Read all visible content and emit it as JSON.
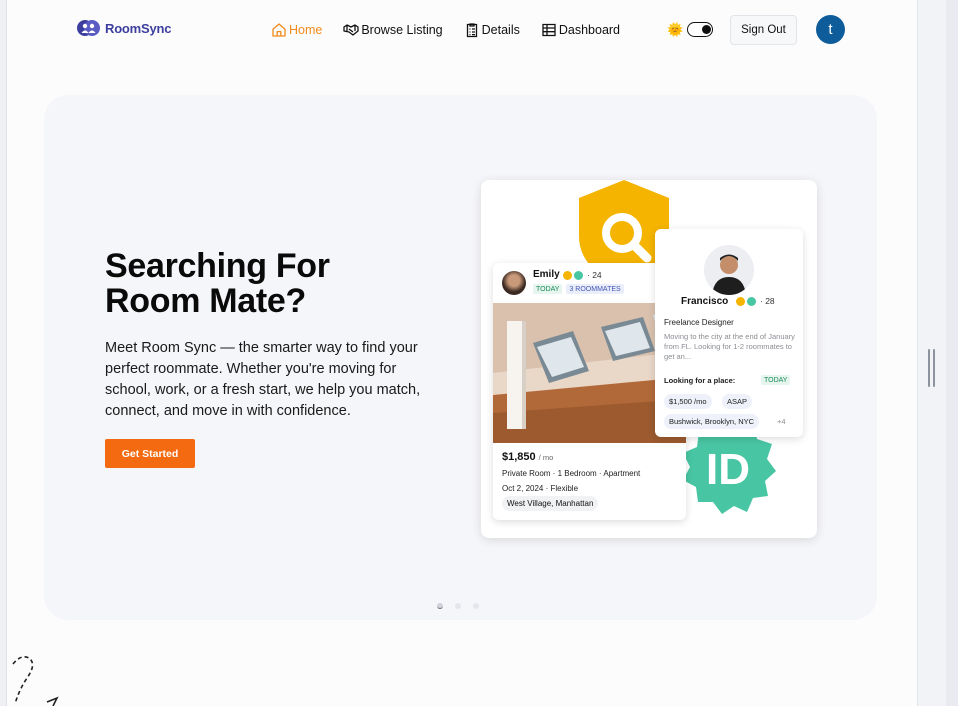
{
  "nav": {
    "logo_text": "RoomSync",
    "links": [
      {
        "label": "Home",
        "icon": "home-icon",
        "active": true
      },
      {
        "label": "Browse Listing",
        "icon": "handshake-icon"
      },
      {
        "label": "Details",
        "icon": "clipboard-icon"
      },
      {
        "label": "Dashboard",
        "icon": "table-icon"
      }
    ],
    "theme_emoji": "🌞",
    "theme_toggle_on": true,
    "sign_out_label": "Sign Out",
    "avatar_initial": "t"
  },
  "hero": {
    "title": "Searching For Room Mate?",
    "description": "Meet Room Sync — the smarter way to find your perfect roommate. Whether you're moving for school, work, or a fresh start, we help you match, connect, and move in with confidence.",
    "cta_label": "Get Started",
    "carousel_dots": 3,
    "active_dot": 0
  },
  "illustration": {
    "emily": {
      "name": "Emily",
      "age": "· 24",
      "tags": [
        "TODAY",
        "3 ROOMMATES"
      ],
      "price": "$1,850",
      "price_unit": "/ mo",
      "room_info": "Private Room · 1 Bedroom · Apartment",
      "date_info": "Oct 2, 2024 · Flexible",
      "location": "West Village, Manhattan"
    },
    "francisco": {
      "name": "Francisco",
      "age": "· 28",
      "role": "Freelance Designer",
      "bio": "Moving to the city at the end of January from FL. Looking for 1-2 roommates to get an...",
      "looking_label": "Looking for a place:",
      "looking_tag": "TODAY",
      "budget": "$1,500 /mo",
      "timing": "ASAP",
      "location": "Bushwick, Brooklyn, NYC",
      "more": "+4"
    },
    "id_badge_text": "ID"
  },
  "colors": {
    "accent_orange": "#f36a10",
    "nav_active": "#f28a1a",
    "brand": "#3d3f9e",
    "avatar_bg": "#0f5c9a",
    "shield_yellow": "#f5b400",
    "shield_green": "#48c6a3"
  }
}
